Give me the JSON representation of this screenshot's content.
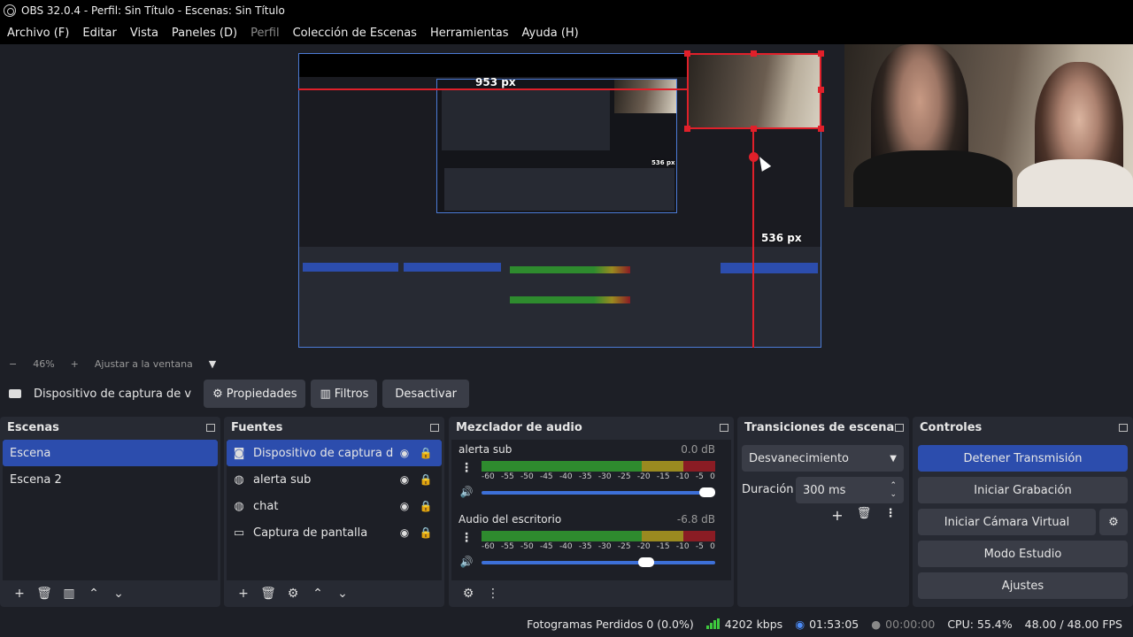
{
  "window": {
    "title": "OBS 32.0.4 - Perfil: Sin Título - Escenas: Sin Título"
  },
  "menu": [
    {
      "label": "Archivo (F)",
      "enabled": true
    },
    {
      "label": "Editar",
      "enabled": true
    },
    {
      "label": "Vista",
      "enabled": true
    },
    {
      "label": "Paneles (D)",
      "enabled": true
    },
    {
      "label": "Perfil",
      "enabled": false
    },
    {
      "label": "Colección de Escenas",
      "enabled": true
    },
    {
      "label": "Herramientas",
      "enabled": true
    },
    {
      "label": "Ayuda (H)",
      "enabled": true
    }
  ],
  "preview": {
    "measure_top": "953 px",
    "measure_right": "536 px",
    "nested_label": "536 px"
  },
  "zoom": {
    "minus": "−",
    "value": "46%",
    "plus": "+",
    "fit_label": "Ajustar a la ventana"
  },
  "source_toolbar": {
    "source_name": "Dispositivo de captura de v",
    "properties": "Propiedades",
    "filters": "Filtros",
    "deactivate": "Desactivar"
  },
  "scenes": {
    "title": "Escenas",
    "items": [
      "Escena",
      "Escena 2"
    ],
    "selected": 0
  },
  "sources": {
    "title": "Fuentes",
    "items": [
      {
        "name": "Dispositivo de captura de v",
        "icon": "camera-icon"
      },
      {
        "name": "alerta sub",
        "icon": "globe-icon"
      },
      {
        "name": "chat",
        "icon": "globe-icon"
      },
      {
        "name": "Captura de pantalla",
        "icon": "monitor-icon"
      }
    ]
  },
  "mixer": {
    "title": "Mezclador de audio",
    "scale": [
      "-60",
      "-55",
      "-50",
      "-45",
      "-40",
      "-35",
      "-30",
      "-25",
      "-20",
      "-15",
      "-10",
      "-5",
      "0"
    ],
    "channels": [
      {
        "name": "alerta sub",
        "db": "0.0 dB",
        "volume": 1.0
      },
      {
        "name": "Audio del escritorio",
        "db": "-6.8 dB",
        "volume": 0.72
      }
    ]
  },
  "transitions": {
    "title": "Transiciones de escena",
    "type": "Desvanecimiento",
    "duration_label": "Duración",
    "duration_value": "300 ms"
  },
  "controls": {
    "title": "Controles",
    "stop_stream": "Detener Transmisión",
    "start_record": "Iniciar Grabación",
    "virtual_cam": "Iniciar Cámara Virtual",
    "studio_mode": "Modo Estudio",
    "settings": "Ajustes"
  },
  "status": {
    "dropped_frames": "Fotogramas Perdidos 0 (0.0%)",
    "bitrate": "4202 kbps",
    "stream_time": "01:53:05",
    "record_time": "00:00:00",
    "cpu": "CPU: 55.4%",
    "fps": "48.00 / 48.00 FPS"
  },
  "colors": {
    "accent": "#2c4dad",
    "guide": "#e0202a",
    "meter_green": "#2e8b2e",
    "meter_yellow": "#9a8a20",
    "meter_red": "#8a1c24"
  }
}
